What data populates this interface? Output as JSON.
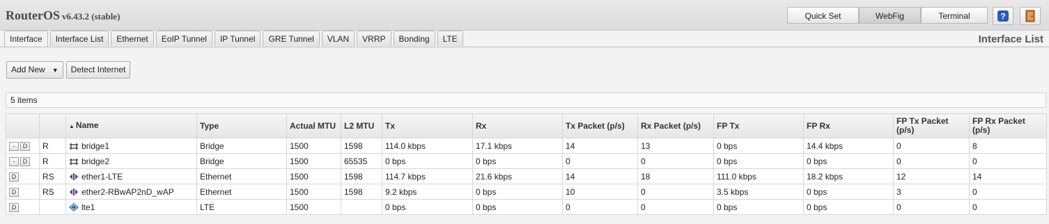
{
  "header": {
    "brand_name": "RouterOS",
    "brand_version": "v6.43.2 (stable)",
    "modes": [
      "Quick Set",
      "WebFig",
      "Terminal"
    ],
    "active_mode": "WebFig"
  },
  "tabs": [
    {
      "label": "Interface",
      "active": true
    },
    {
      "label": "Interface List"
    },
    {
      "label": "Ethernet"
    },
    {
      "label": "EoIP Tunnel"
    },
    {
      "label": "IP Tunnel"
    },
    {
      "label": "GRE Tunnel"
    },
    {
      "label": "VLAN"
    },
    {
      "label": "VRRP"
    },
    {
      "label": "Bonding"
    },
    {
      "label": "LTE"
    }
  ],
  "page_title": "Interface List",
  "actions": {
    "add_new": "Add New",
    "add_new_arrow": "▼",
    "detect_internet": "Detect Internet"
  },
  "item_count": "5 items",
  "table": {
    "headers": {
      "name": "Name",
      "sort_indicator": "▲",
      "type": "Type",
      "actual_mtu": "Actual MTU",
      "l2_mtu": "L2 MTU",
      "tx": "Tx",
      "rx": "Rx",
      "tx_packet": "Tx Packet (p/s)",
      "rx_packet": "Rx Packet (p/s)",
      "fp_tx": "FP Tx",
      "fp_rx": "FP Rx",
      "fp_tx_packet": "FP Tx Packet (p/s)",
      "fp_rx_packet": "FP Rx Packet (p/s)"
    },
    "rows": [
      {
        "remove": "-",
        "disable": "D",
        "flags": "R",
        "icon": "bridge-icon",
        "name": "bridge1",
        "type": "Bridge",
        "actual_mtu": "1500",
        "l2_mtu": "1598",
        "tx": "114.0 kbps",
        "rx": "17.1 kbps",
        "tx_packet": "14",
        "rx_packet": "13",
        "fp_tx": "0 bps",
        "fp_rx": "14.4 kbps",
        "fp_tx_packet": "0",
        "fp_rx_packet": "8"
      },
      {
        "remove": "-",
        "disable": "D",
        "flags": "R",
        "icon": "bridge-icon",
        "name": "bridge2",
        "type": "Bridge",
        "actual_mtu": "1500",
        "l2_mtu": "65535",
        "tx": "0 bps",
        "rx": "0 bps",
        "tx_packet": "0",
        "rx_packet": "0",
        "fp_tx": "0 bps",
        "fp_rx": "0 bps",
        "fp_tx_packet": "0",
        "fp_rx_packet": "0"
      },
      {
        "remove": "",
        "disable": "D",
        "flags": "RS",
        "icon": "ethernet-icon",
        "name": "ether1-LTE",
        "type": "Ethernet",
        "actual_mtu": "1500",
        "l2_mtu": "1598",
        "tx": "114.7 kbps",
        "rx": "21.6 kbps",
        "tx_packet": "14",
        "rx_packet": "18",
        "fp_tx": "111.0 kbps",
        "fp_rx": "18.2 kbps",
        "fp_tx_packet": "12",
        "fp_rx_packet": "14"
      },
      {
        "remove": "",
        "disable": "D",
        "flags": "RS",
        "icon": "ethernet-icon",
        "name": "ether2-RBwAP2nD_wAP",
        "type": "Ethernet",
        "actual_mtu": "1500",
        "l2_mtu": "1598",
        "tx": "9.2 kbps",
        "rx": "0 bps",
        "tx_packet": "10",
        "rx_packet": "0",
        "fp_tx": "3.5 kbps",
        "fp_rx": "0 bps",
        "fp_tx_packet": "3",
        "fp_rx_packet": "0"
      },
      {
        "remove": "",
        "disable": "D",
        "flags": "",
        "icon": "lte-icon",
        "name": "lte1",
        "type": "LTE",
        "actual_mtu": "1500",
        "l2_mtu": "",
        "tx": "0 bps",
        "rx": "0 bps",
        "tx_packet": "0",
        "rx_packet": "0",
        "fp_tx": "0 bps",
        "fp_rx": "0 bps",
        "fp_tx_packet": "0",
        "fp_rx_packet": "0"
      }
    ]
  },
  "colors": {
    "help_icon_bg": "#2b5cb8",
    "logout_icon": "#b5651d",
    "bridge_icon": "#333333",
    "ethernet_icon": "#5a3d7a",
    "lte_icon": "#2d6fa3"
  }
}
